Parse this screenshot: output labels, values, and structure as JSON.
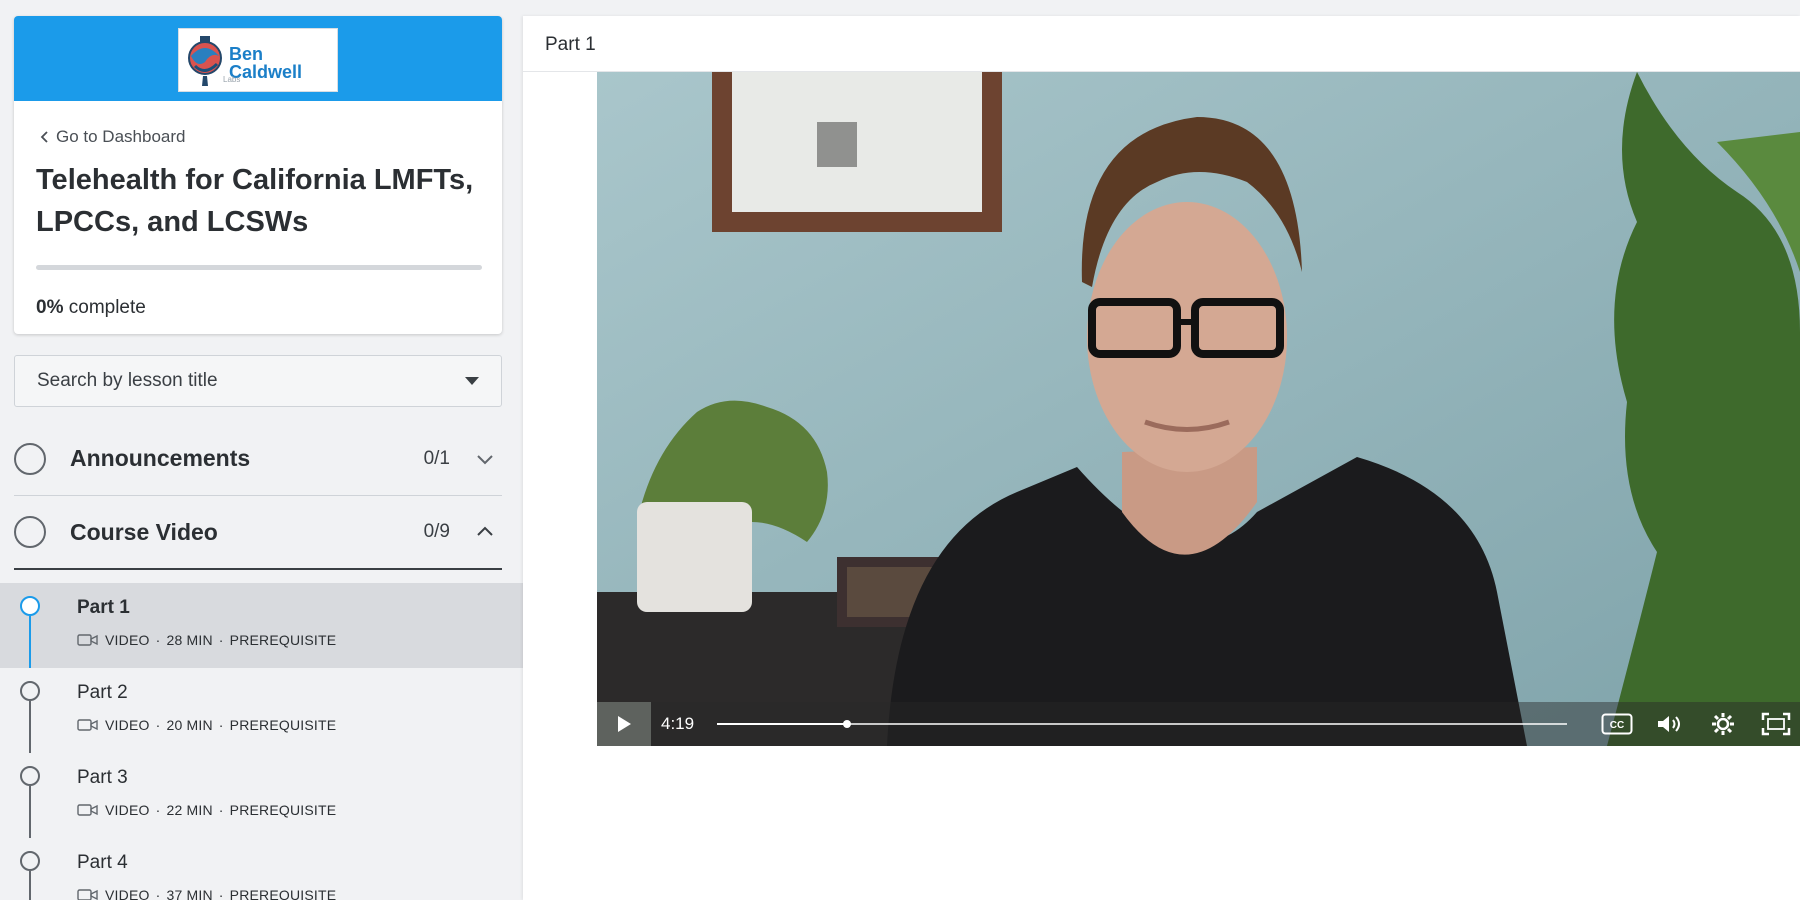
{
  "brand": {
    "logo_name": "Ben Caldwell",
    "logo_sub": "Labs",
    "header_color": "#1b9bea"
  },
  "sidebar": {
    "back_label": "Go to Dashboard",
    "course_title": "Telehealth for California LMFTs, LPCCs, and LCSWs",
    "progress_percent": 0,
    "progress_value": "0%",
    "progress_suffix": "complete",
    "search_placeholder": "Search by lesson title",
    "sections": [
      {
        "name": "Announcements",
        "count": "0/1",
        "expanded": false
      },
      {
        "name": "Course Video",
        "count": "0/9",
        "expanded": true
      }
    ],
    "lessons": [
      {
        "title": "Part 1",
        "type": "VIDEO",
        "duration": "28 MIN",
        "tag": "PREREQUISITE",
        "current": true
      },
      {
        "title": "Part 2",
        "type": "VIDEO",
        "duration": "20 MIN",
        "tag": "PREREQUISITE",
        "current": false
      },
      {
        "title": "Part 3",
        "type": "VIDEO",
        "duration": "22 MIN",
        "tag": "PREREQUISITE",
        "current": false
      },
      {
        "title": "Part 4",
        "type": "VIDEO",
        "duration": "37 MIN",
        "tag": "PREREQUISITE",
        "current": false
      }
    ]
  },
  "main": {
    "lesson_title": "Part 1",
    "player": {
      "time": "4:19",
      "played_fraction": 0.153,
      "icons": [
        "play-icon",
        "closed-captions-icon",
        "volume-icon",
        "settings-icon",
        "fullscreen-icon"
      ]
    }
  }
}
